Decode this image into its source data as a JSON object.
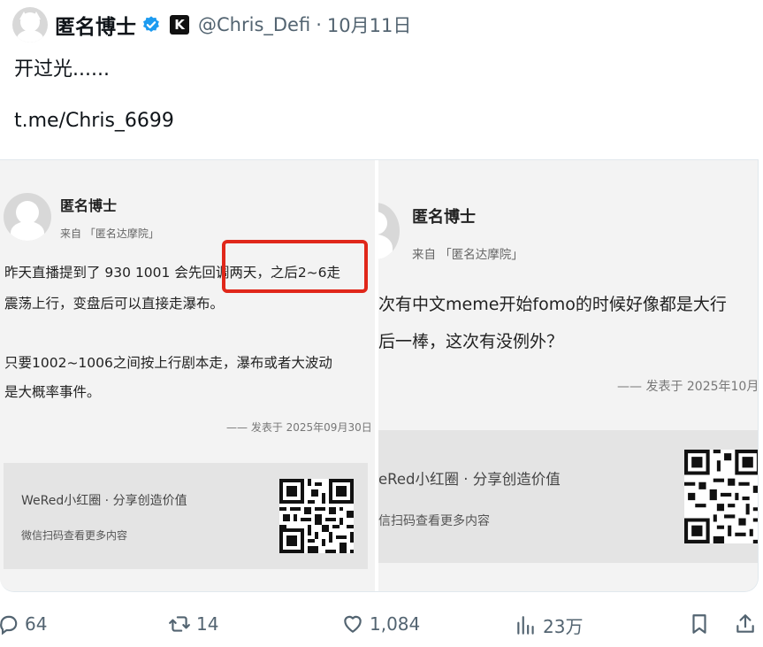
{
  "tweet": {
    "author_name": "匿名博士",
    "handle": "@Chris_Defi",
    "separator": "·",
    "date": "10月11日",
    "badge_letter": "K",
    "text_line1": "开过光......",
    "text_line2": "t.me/Chris_6699"
  },
  "left_card": {
    "name": "匿名博士",
    "source": "来自 「匿名达摩院」",
    "body": [
      "昨天直播提到了 930 1001 会先回调两天，之后2~6走",
      "震荡上行，变盘后可以直接走瀑布。",
      "只要1002~1006之间按上行剧本走，瀑布或者大波动",
      "是大概率事件。"
    ],
    "published": "—— 发表于 2025年09月30日",
    "footer_title": "WeRed小红圈 · 分享创造价值",
    "footer_sub": "微信扫码查看更多内容"
  },
  "right_card": {
    "name": "匿名博士",
    "source": "来自 「匿名达摩院」",
    "body": [
      "次有中文meme开始fomo的时候好像都是大行",
      "后一棒，这次有没例外？"
    ],
    "published": "—— 发表于 2025年10月",
    "footer_title": "eRed小红圈 · 分享创造价值",
    "footer_sub": "信扫码查看更多内容"
  },
  "actions": {
    "replies": "64",
    "reposts": "14",
    "likes": "1,084",
    "views": "23万"
  },
  "colors": {
    "verified_blue": "#1d9bf0",
    "highlight_red": "#e0271a",
    "muted_text": "#536471"
  }
}
